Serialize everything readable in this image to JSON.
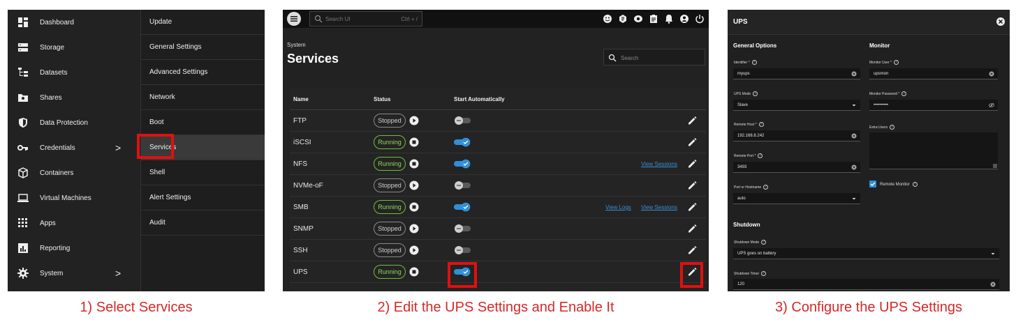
{
  "panel1": {
    "nav": [
      {
        "label": "Dashboard",
        "icon": "dashboard-icon"
      },
      {
        "label": "Storage",
        "icon": "storage-icon"
      },
      {
        "label": "Datasets",
        "icon": "datasets-icon"
      },
      {
        "label": "Shares",
        "icon": "shares-icon"
      },
      {
        "label": "Data Protection",
        "icon": "shield-icon"
      },
      {
        "label": "Credentials",
        "icon": "key-icon",
        "chevron": ">"
      },
      {
        "label": "Containers",
        "icon": "cube-icon"
      },
      {
        "label": "Virtual Machines",
        "icon": "laptop-icon"
      },
      {
        "label": "Apps",
        "icon": "apps-grid-icon"
      },
      {
        "label": "Reporting",
        "icon": "reporting-icon"
      },
      {
        "label": "System",
        "icon": "gear-icon",
        "chevron": ">"
      }
    ],
    "submenu": [
      "Update",
      "General Settings",
      "Advanced Settings",
      "Network",
      "Boot",
      "Services",
      "Shell",
      "Alert Settings",
      "Audit"
    ],
    "active_submenu": "Services"
  },
  "panel2": {
    "search_ui": {
      "placeholder": "Search UI",
      "shortcut": "Ctrl + /"
    },
    "breadcrumb": "System",
    "title": "Services",
    "search_placeholder": "Search",
    "columns": [
      "Name",
      "Status",
      "Start Automatically"
    ],
    "rows": [
      {
        "name": "FTP",
        "status": "Stopped",
        "auto": false,
        "links": []
      },
      {
        "name": "iSCSI",
        "status": "Running",
        "auto": true,
        "links": []
      },
      {
        "name": "NFS",
        "status": "Running",
        "auto": true,
        "links": [
          "View Sessions"
        ]
      },
      {
        "name": "NVMe-oF",
        "status": "Stopped",
        "auto": false,
        "links": []
      },
      {
        "name": "SMB",
        "status": "Running",
        "auto": true,
        "links": [
          "View Logs",
          "View Sessions"
        ]
      },
      {
        "name": "SNMP",
        "status": "Stopped",
        "auto": false,
        "links": []
      },
      {
        "name": "SSH",
        "status": "Stopped",
        "auto": false,
        "links": []
      },
      {
        "name": "UPS",
        "status": "Running",
        "auto": true,
        "links": []
      }
    ]
  },
  "panel3": {
    "title": "UPS",
    "general_options": "General Options",
    "monitor": "Monitor",
    "shutdown": "Shutdown",
    "fields": {
      "identifier": {
        "label": "Identifier *",
        "value": "myups"
      },
      "ups_mode": {
        "label": "UPS Mode",
        "value": "Slave"
      },
      "remote_host": {
        "label": "Remote Host *",
        "value": "192.168.8.242"
      },
      "remote_port": {
        "label": "Remote Port *",
        "value": "3493"
      },
      "port_or_hostname": {
        "label": "Port or Hostname",
        "value": "auto"
      },
      "monitor_user": {
        "label": "Monitor User *",
        "value": "upsmon"
      },
      "monitor_password": {
        "label": "Monitor Password *",
        "value": "••••••••••"
      },
      "extra_users": {
        "label": "Extra Users",
        "value": ""
      },
      "remote_monitor": {
        "label": "Remote Monitor",
        "checked": true
      },
      "shutdown_mode": {
        "label": "Shutdown Mode",
        "value": "UPS goes on battery"
      },
      "shutdown_timer": {
        "label": "Shutdown Timer",
        "value": "120"
      }
    }
  },
  "captions": [
    "1) Select Services",
    "2) Edit the UPS Settings and Enable It",
    "3) Configure the UPS Settings"
  ],
  "colors": {
    "highlight": "#e01010",
    "caption": "#d62828",
    "running": "#6fbf3c",
    "toggle_on": "#2f8fd8",
    "link": "#3a8fd6"
  }
}
